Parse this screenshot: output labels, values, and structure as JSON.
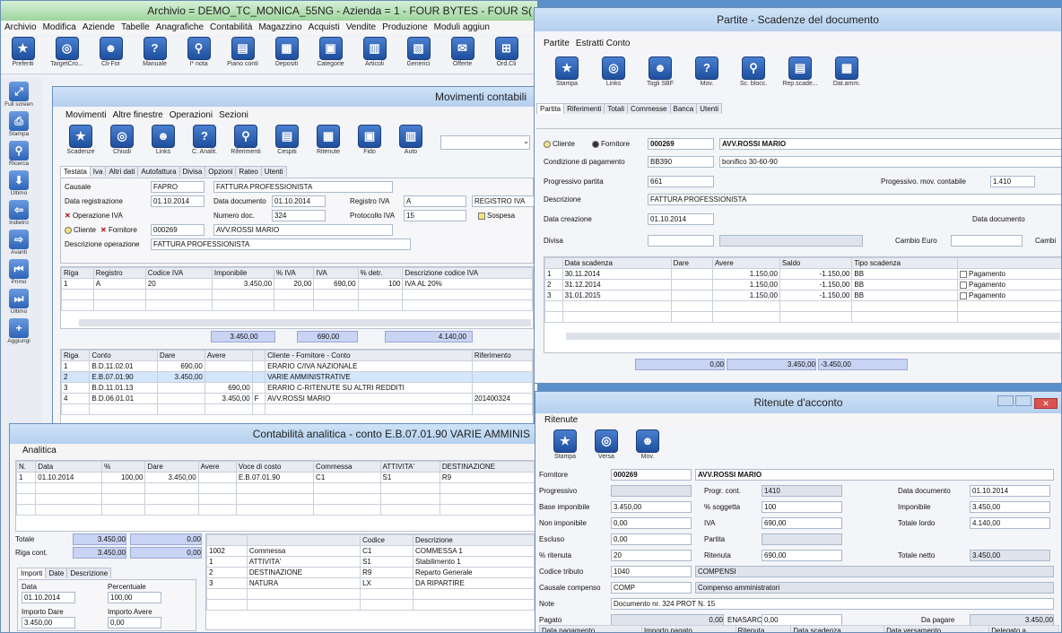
{
  "main": {
    "title": "Archivio = DEMO_TC_MONICA_55NG - Azienda = 1 - FOUR BYTES - FOUR S(",
    "menu": [
      "Archivio",
      "Modifica",
      "Aziende",
      "Tabelle",
      "Anagrafiche",
      "Contabilità",
      "Magazzino",
      "Acquisti",
      "Vendite",
      "Produzione",
      "Moduli aggiun"
    ],
    "toolbar": [
      "Preferiti",
      "TargetCro...",
      "Cli-For",
      "Manuale",
      "I* nota",
      "Piano conti",
      "Depositi",
      "Categorie",
      "Articoli",
      "Generici",
      "Offerte",
      "Ord.Cli"
    ],
    "side": [
      "Full screen",
      "Stampa",
      "Ricerca",
      "Ultimo",
      "Indietro",
      "Avanti",
      "Primo",
      "Ultimo",
      "Aggiungi"
    ]
  },
  "mov": {
    "title": "Movimenti contabili",
    "menu": [
      "Movimenti",
      "Altre finestre",
      "Operazioni",
      "Sezioni"
    ],
    "toolbar": [
      "Scadenze",
      "Chiudi",
      "Links",
      "C. Analit.",
      "Riferimenti",
      "Cespiti",
      "Ritenute",
      "Fido",
      "Auto"
    ],
    "tabs": [
      "Testata",
      "Iva",
      "Altri dati",
      "Autofattura",
      "Divisa",
      "Opzioni",
      "Rateo",
      "Utenti"
    ],
    "causale_label": "Causale",
    "causale": "FAPRO",
    "causale_desc": "FATTURA PROFESSIONISTA",
    "data_reg_label": "Data registrazione",
    "data_reg": "01.10.2014",
    "data_doc_label": "Data documento",
    "data_doc": "01.10.2014",
    "registro_label": "Registro IVA",
    "registro": "A",
    "registro_desc": "REGISTRO IVA",
    "op_iva": "Operazione IVA",
    "num_doc_label": "Numero doc.",
    "num_doc": "324",
    "protocollo_label": "Protocollo IVA",
    "protocollo": "15",
    "sospesa": "Sospesa",
    "cliente": "Cliente",
    "fornitore": "Fornitore",
    "fornitore_code": "000269",
    "fornitore_name": "AVV.ROSSI MARIO",
    "desc_label": "Descrizione operazione",
    "desc": "FATTURA PROFESSIONISTA",
    "iva_headers": [
      "Riga",
      "Registro",
      "Codice IVA",
      "Imponibile",
      "% IVA",
      "IVA",
      "% detr.",
      "Descrizione codice IVA"
    ],
    "iva_rows": [
      [
        "1",
        "A",
        "20",
        "3.450,00",
        "20,00",
        "690,00",
        "100",
        "IVA AL 20%"
      ]
    ],
    "iva_totals": [
      "3.450,00",
      "690,00",
      "4.140,00"
    ],
    "cont_headers": [
      "Riga",
      "Conto",
      "Dare",
      "Avere",
      "Cliente - Fornitore - Conto",
      "Riferimento"
    ],
    "cont_rows": [
      [
        "1",
        "B.D.11.02.01",
        "690,00",
        "",
        "",
        "ERARIO C/IVA NAZIONALE",
        ""
      ],
      [
        "2",
        "E.B.07.01.90",
        "3.450,00",
        "",
        "",
        "VARIE AMMINISTRATIVE",
        ""
      ],
      [
        "3",
        "B.D.11.01.13",
        "",
        "690,00",
        "",
        "ERARIO C-RITENUTE SU ALTRI REDDITI",
        ""
      ],
      [
        "4",
        "B.D.06.01.01",
        "",
        "3.450,00",
        "F",
        "AVV.ROSSI MARIO",
        "201400324"
      ]
    ]
  },
  "ana": {
    "title": "Contabilità analitica - conto E.B.07.01.90 VARIE AMMINIS",
    "menu": "Analitica",
    "headers": [
      "N.",
      "Data",
      "%",
      "Dare",
      "Avere",
      "Voce di costo",
      "Commessa",
      "ATTIVITA'",
      "DESTINAZIONE"
    ],
    "rows": [
      [
        "1",
        "01.10.2014",
        "100,00",
        "3.450,00",
        "",
        "E.B.07.01.90",
        "C1",
        "S1",
        "R9"
      ]
    ],
    "totale_label": "Totale",
    "totale": "3.450,00",
    "totale_avere": "0,00",
    "riga_label": "Riga cont.",
    "riga": "3.450,00",
    "riga_avere": "0,00",
    "sub_tabs": [
      "Importi",
      "Date",
      "Descrizione"
    ],
    "data_label": "Data",
    "data": "01.10.2014",
    "perc_label": "Percentuale",
    "perc": "100,00",
    "imp_dare_label": "Importo Dare",
    "imp_dare": "3.450,00",
    "imp_avere_label": "Importo Avere",
    "imp_avere": "0,00",
    "cod_headers": [
      "",
      "Codice",
      "Descrizione"
    ],
    "cod_rows": [
      [
        "1002",
        "Commessa",
        "C1",
        "COMMESSA 1"
      ],
      [
        "1",
        "ATTIVITA'",
        "S1",
        "Stabilimento 1"
      ],
      [
        "2",
        "DESTINAZIONE",
        "R9",
        "Reparto Generale"
      ],
      [
        "3",
        "NATURA",
        "LX",
        "DA RIPARTIRE"
      ]
    ]
  },
  "part": {
    "title": "Partite - Scadenze del documento",
    "menu": [
      "Partite",
      "Estratti Conto"
    ],
    "toolbar": [
      "Stampa",
      "Links",
      "Togli SBF",
      "Mov.",
      "Sc. blocc.",
      "Rep.scade...",
      "Dat.amm."
    ],
    "tabs": [
      "Partita",
      "Riferimenti",
      "Totali",
      "Commesse",
      "Banca",
      "Utenti"
    ],
    "cliente": "Cliente",
    "fornitore": "Fornitore",
    "code": "000269",
    "name": "AVV.ROSSI MARIO",
    "cond_label": "Condizione di pagamento",
    "cond": "BB390",
    "cond_desc": "bonifico 30-60-90",
    "prog_label": "Progressivo partita",
    "prog": "661",
    "prog_mov_label": "Progessivo. mov. contabile",
    "prog_mov": "1.410",
    "desc_label": "Descrizione",
    "desc": "FATTURA PROFESSIONISTA",
    "data_cre_label": "Data creazione",
    "data_cre": "01.10.2014",
    "data_doc_label": "Data documento",
    "divisa_label": "Divisa",
    "cambio_label": "Cambio Euro",
    "cambi_label": "Cambi",
    "headers": [
      "",
      "Data scadenza",
      "Dare",
      "Avere",
      "Saldo",
      "",
      "Tipo scadenza",
      ""
    ],
    "rows": [
      [
        "1",
        "30.11.2014",
        "",
        "1.150,00",
        "-1.150,00",
        "BB",
        "Pagamento"
      ],
      [
        "2",
        "31.12.2014",
        "",
        "1.150,00",
        "-1.150,00",
        "BB",
        "Pagamento"
      ],
      [
        "3",
        "31.01.2015",
        "",
        "1.150,00",
        "-1.150,00",
        "BB",
        "Pagamento"
      ]
    ],
    "totals": [
      "0,00",
      "3.450,00",
      "-3.450,00"
    ]
  },
  "rit": {
    "title": "Ritenute d'acconto",
    "menu": "Ritenute",
    "toolbar": [
      "Stampa",
      "Versa",
      "Mov."
    ],
    "fornitore_label": "Fornitore",
    "fornitore_code": "000269",
    "fornitore_name": "AVV.ROSSI MARIO",
    "progressivo_label": "Progressivo",
    "progr_cont_label": "Progr. cont.",
    "progr_cont": "1410",
    "data_doc_label": "Data documento",
    "data_doc": "01.10.2014",
    "base_label": "Base imponibile",
    "base": "3.450,00",
    "perc_sogg_label": "% soggetta",
    "perc_sogg": "100",
    "imponibile_label": "Imponibile",
    "imponibile": "3.450,00",
    "non_imp_label": "Non imponibile",
    "non_imp": "0,00",
    "iva_label": "IVA",
    "iva": "690,00",
    "tot_lordo_label": "Totale lordo",
    "tot_lordo": "4.140,00",
    "escluso_label": "Escluso",
    "escluso": "0,00",
    "partita_label": "Partita",
    "perc_rit_label": "% ritenuta",
    "perc_rit": "20",
    "ritenuta_label": "Ritenuta",
    "ritenuta": "690,00",
    "tot_netto_label": "Totale netto",
    "tot_netto": "3.450,00",
    "cod_trib_label": "Codice tributo",
    "cod_trib": "1040",
    "cod_trib_desc": "COMPENSI",
    "causale_label": "Causale compenso",
    "causale": "COMP",
    "causale_desc": "Compenso amministratori",
    "note_label": "Note",
    "note": "Documento nr. 324 PROT N. 15",
    "pagato_label": "Pagato",
    "pagato": "0,00",
    "enasarco_label": "ENASARCO",
    "enasarco": "0,00",
    "da_pagare_label": "Da pagare",
    "da_pagare": "3.450,00",
    "foot_headers": [
      "Data pagamento",
      "Importo pagato",
      "Ritenuta",
      "Data scadenza",
      "Data versamento",
      "Delegato a"
    ]
  }
}
